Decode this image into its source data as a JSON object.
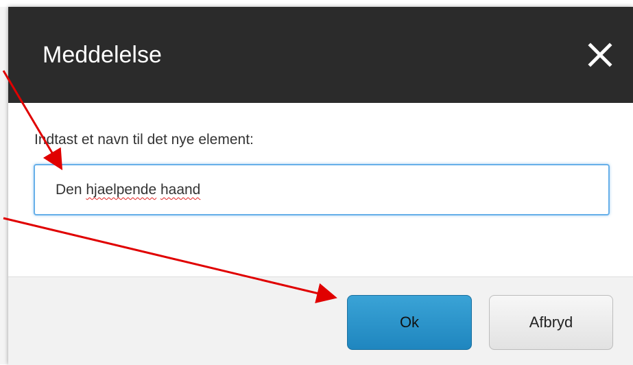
{
  "dialog": {
    "title": "Meddelelse",
    "prompt": "Indtast et navn til det nye element:",
    "input": {
      "value_parts": [
        "Den ",
        "hjaelpende",
        " ",
        "haand"
      ]
    },
    "buttons": {
      "ok_label": "Ok",
      "cancel_label": "Afbryd"
    }
  },
  "colors": {
    "header_bg": "#2b2b2b",
    "ok_button": "#2a95cc",
    "input_focus_border": "#66afe9",
    "annotation_arrow": "#e00000"
  },
  "icons": {
    "close": "close-icon"
  }
}
